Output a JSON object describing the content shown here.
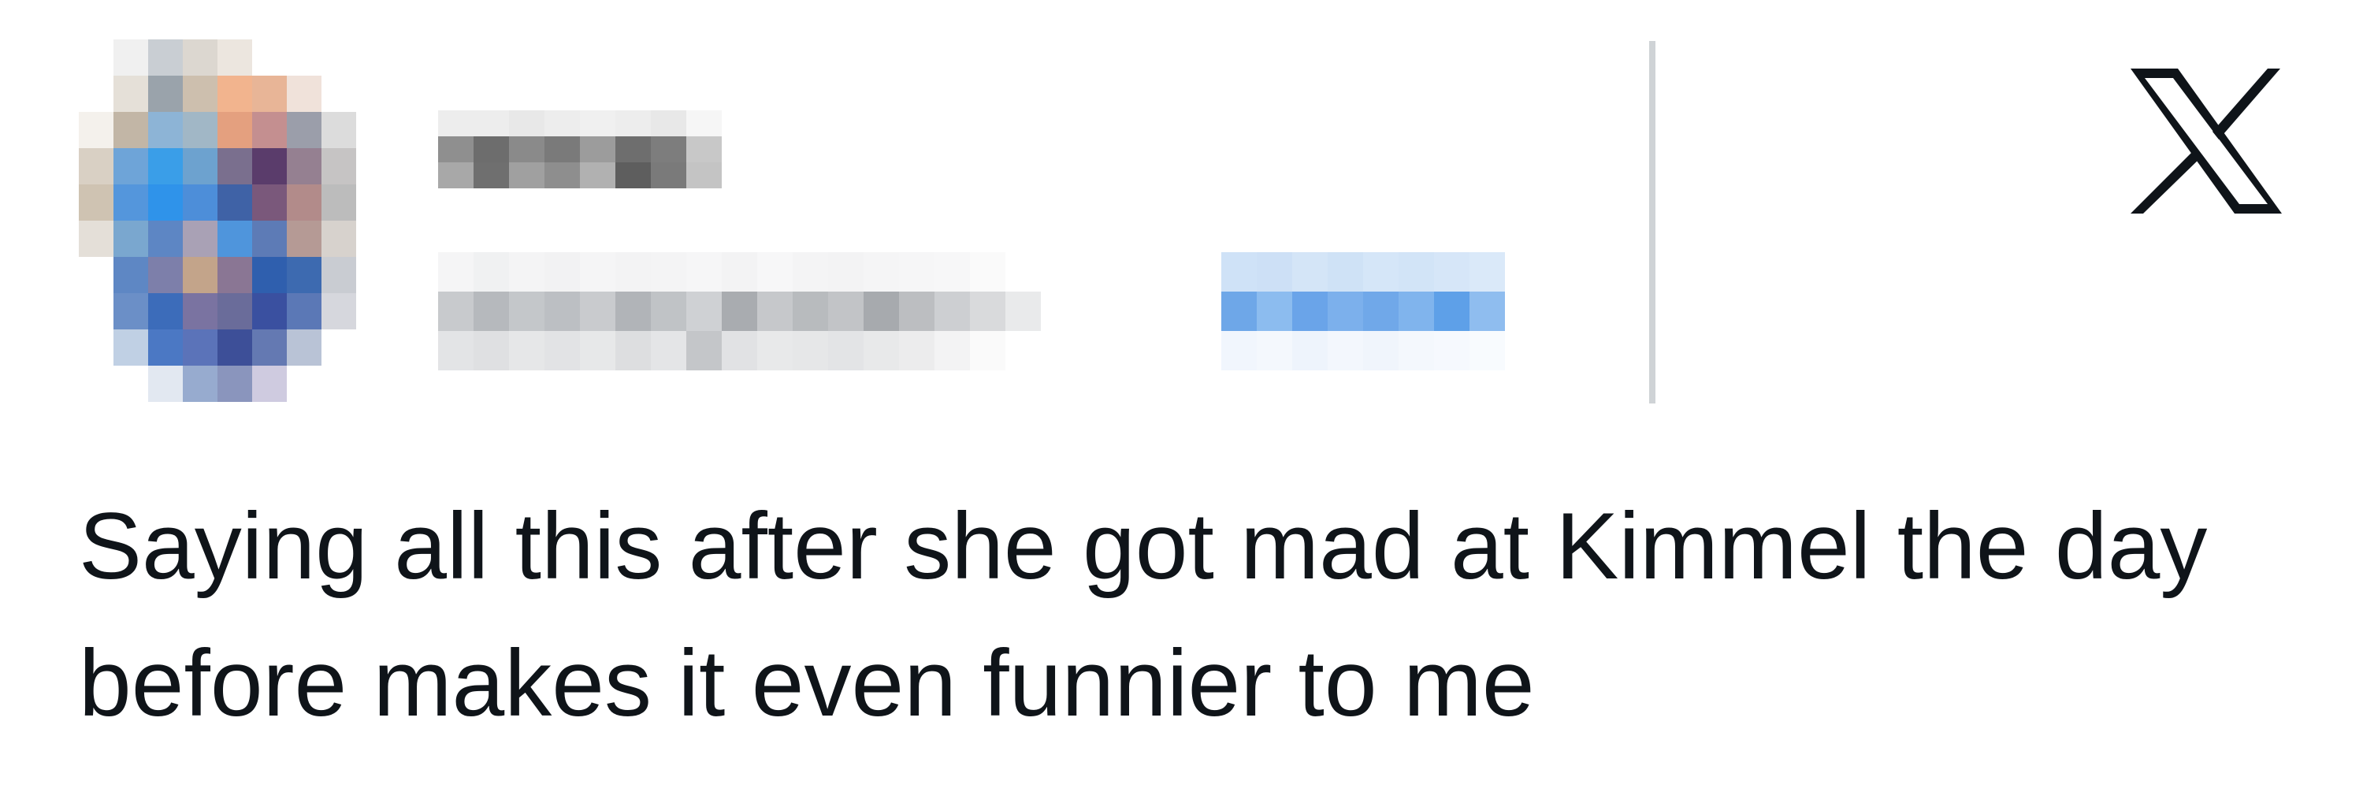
{
  "post": {
    "avatar_icon": "user-avatar-blurred",
    "display_name": "",
    "handle": "",
    "follow_label": "",
    "body_text": "Saying all this after she got mad at Kimmel the day before makes it even funnier to me"
  },
  "brand": {
    "logo_icon": "x-logo-icon",
    "logo_color": "#0f1419"
  },
  "colors": {
    "text": "#0f1419",
    "divider": "#cfd3d6",
    "follow_blue": "#5ea2e8"
  }
}
